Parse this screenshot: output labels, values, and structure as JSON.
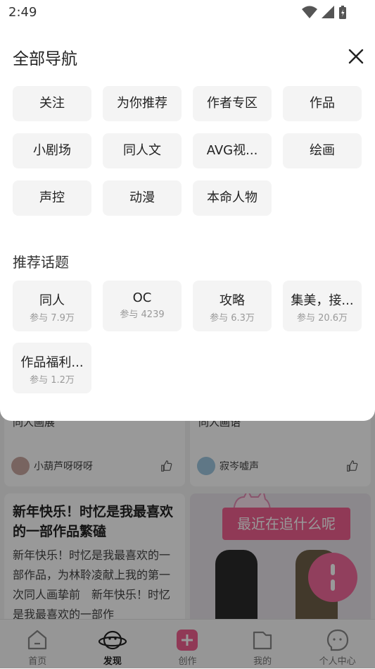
{
  "status_bar": {
    "time": "2:49"
  },
  "background": {
    "card_left": {
      "caption": "同人画展",
      "user": "小葫芦呀呀呀"
    },
    "card_right": {
      "caption": "同人画语",
      "user": "寂岑嘘声"
    },
    "post": {
      "title": "新年快乐！时忆是我最喜欢的一部作品繁磕",
      "body": "新年快乐！时忆是我最喜欢的一部作品，为林聆凌献上我的第一次同人画挚前　新年快乐！时忆是我最喜欢的一部作"
    },
    "promo_text": "最近在追什么呢",
    "tabs": [
      {
        "label": "首页",
        "icon": "home-icon"
      },
      {
        "label": "发现",
        "icon": "planet-icon"
      },
      {
        "label": "创作",
        "icon": "plus-icon"
      },
      {
        "label": "我的",
        "icon": "folder-icon"
      },
      {
        "label": "个人中心",
        "icon": "face-icon"
      }
    ]
  },
  "sheet": {
    "title": "全部导航",
    "nav_items": [
      "关注",
      "为你推荐",
      "作者专区",
      "作品",
      "小剧场",
      "同人文",
      "AVG视...",
      "绘画",
      "声控",
      "动漫",
      "本命人物"
    ],
    "topics_title": "推荐话题",
    "topics": [
      {
        "name": "同人",
        "count": "参与 7.9万"
      },
      {
        "name": "OC",
        "count": "参与 4239"
      },
      {
        "name": "攻略",
        "count": "参与 6.3万"
      },
      {
        "name": "集美，接...",
        "count": "参与 20.6万"
      },
      {
        "name": "作品福利...",
        "count": "参与 1.2万"
      }
    ]
  },
  "colors": {
    "accent": "#f06090",
    "chip_bg": "#f4f4f4"
  }
}
